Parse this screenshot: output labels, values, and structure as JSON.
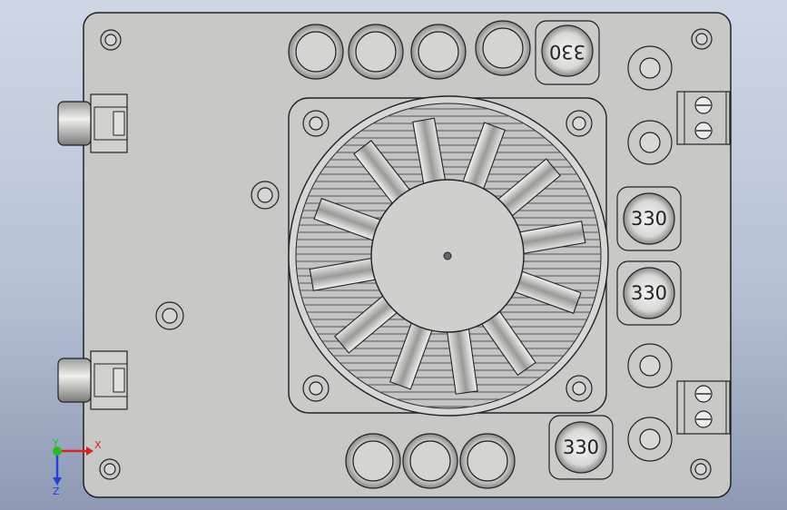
{
  "viewport": {
    "background_top": "#cfd7e6",
    "background_bottom": "#8e9ab4",
    "part_color": "#c8c8c6"
  },
  "inductor_labels": {
    "top": "330",
    "right_upper": "330",
    "right_lower": "330",
    "bottom": "330"
  },
  "triad": {
    "x_label": "X",
    "y_label": "Y",
    "z_label": "Z",
    "x_color": "#e02020",
    "y_color": "#20c020",
    "z_color": "#2040e0"
  }
}
